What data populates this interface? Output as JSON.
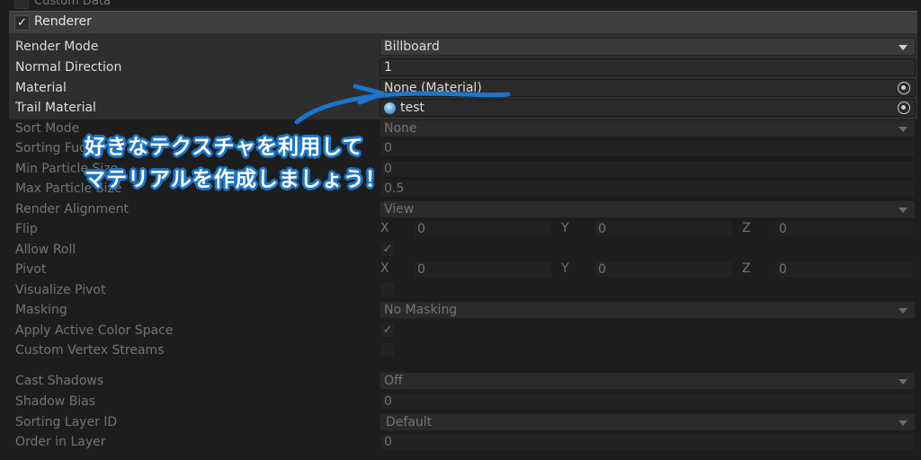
{
  "colors": {
    "accent": "#1c75c9",
    "annotation_text": "#ffffff"
  },
  "top_cut": {
    "label": "Custom Data"
  },
  "module": {
    "title": "Renderer",
    "checked": true
  },
  "rows": {
    "render_mode": {
      "label": "Render Mode",
      "value": "Billboard"
    },
    "normal_direction": {
      "label": "Normal Direction",
      "value": "1"
    },
    "material": {
      "label": "Material",
      "value": "None (Material)",
      "icon": "object-picker-icon"
    },
    "trail_material": {
      "label": "Trail Material",
      "value": "test",
      "icon": "object-picker-icon",
      "asset_icon": "material-icon"
    },
    "sort_mode": {
      "label": "Sort Mode",
      "value": "None"
    },
    "sorting_fudge": {
      "label": "Sorting Fudge",
      "value": "0"
    },
    "min_particle_size": {
      "label": "Min Particle Size",
      "value": "0"
    },
    "max_particle_size": {
      "label": "Max Particle Size",
      "value": "0.5"
    },
    "render_alignment": {
      "label": "Render Alignment",
      "value": "View"
    },
    "flip": {
      "label": "Flip",
      "x_label": "X",
      "y_label": "Y",
      "z_label": "Z",
      "x": "0",
      "y": "0",
      "z": "0"
    },
    "allow_roll": {
      "label": "Allow Roll",
      "checked": true
    },
    "pivot": {
      "label": "Pivot",
      "x_label": "X",
      "y_label": "Y",
      "z_label": "Z",
      "x": "0",
      "y": "0",
      "z": "0"
    },
    "visualize_pivot": {
      "label": "Visualize Pivot",
      "checked": false
    },
    "masking": {
      "label": "Masking",
      "value": "No Masking"
    },
    "apply_active_color_space": {
      "label": "Apply Active Color Space",
      "checked": true
    },
    "custom_vertex_streams": {
      "label": "Custom Vertex Streams",
      "checked": false
    },
    "cast_shadows": {
      "label": "Cast Shadows",
      "value": "Off"
    },
    "shadow_bias": {
      "label": "Shadow Bias",
      "value": "0"
    },
    "sorting_layer_id": {
      "label": "Sorting Layer ID",
      "value": "Default"
    },
    "order_in_layer": {
      "label": "Order in Layer",
      "value": "0"
    }
  },
  "annotation": {
    "line1": "好きなテクスチャを利用して",
    "line2": "マテリアルを作成しましょう！"
  }
}
